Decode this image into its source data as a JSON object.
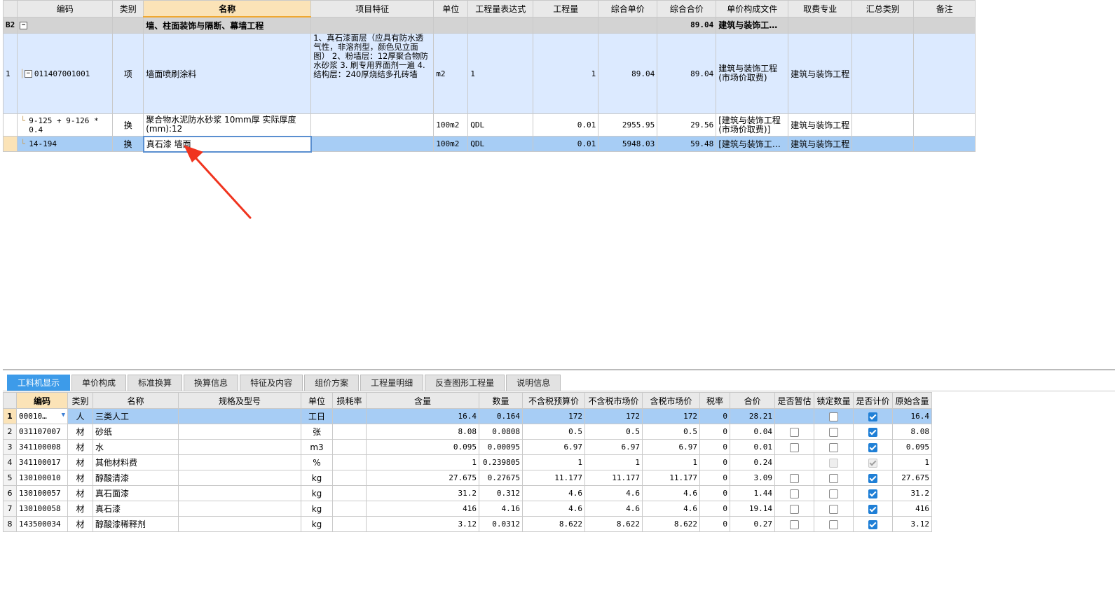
{
  "upper": {
    "columns": [
      "编码",
      "类别",
      "名称",
      "项目特征",
      "单位",
      "工程量表达式",
      "工程量",
      "综合单价",
      "综合合价",
      "单价构成文件",
      "取费专业",
      "汇总类别",
      "备注"
    ],
    "section": {
      "rownum": "B2",
      "name": "墙、柱面装饰与隔断、幕墙工程",
      "total": "89.04",
      "file": "建筑与装饰工…"
    },
    "item": {
      "rownum": "1",
      "code": "011407001001",
      "type": "项",
      "name": "墙面喷刷涂料",
      "features": "1、真石漆面层（应具有防水透气性，非溶剂型，颜色见立面图）\n2、粉墙层：12厚聚合物防水砂浆\n3. 刷专用界面剂一遍\n4.结构层：240厚烧结多孔砖墙",
      "unit": "m2",
      "expr": "1",
      "qty": "1",
      "price": "89.04",
      "total": "89.04",
      "file": "建筑与装饰工程(市场价取费)",
      "major": "建筑与装饰工程"
    },
    "subs": [
      {
        "code": "9-125 + 9-126 * 0.4",
        "type": "换",
        "name": "聚合物水泥防水砂浆 10mm厚  实际厚度(mm):12",
        "unit": "100m2",
        "expr": "QDL",
        "qty": "0.01",
        "price": "2955.95",
        "total": "29.56",
        "file": "[建筑与装饰工程(市场价取费)]",
        "major": "建筑与装饰工程"
      },
      {
        "code": "14-194",
        "type": "换",
        "name": "真石漆 墙面",
        "unit": "100m2",
        "expr": "QDL",
        "qty": "0.01",
        "price": "5948.03",
        "total": "59.48",
        "file": "[建筑与装饰工…",
        "major": "建筑与装饰工程"
      }
    ]
  },
  "tabs": [
    "工料机显示",
    "单价构成",
    "标准换算",
    "换算信息",
    "特征及内容",
    "组价方案",
    "工程量明细",
    "反查图形工程量",
    "说明信息"
  ],
  "lower": {
    "columns": [
      "编码",
      "类别",
      "名称",
      "规格及型号",
      "单位",
      "损耗率",
      "含量",
      "数量",
      "不含税预算价",
      "不含税市场价",
      "含税市场价",
      "税率",
      "合价",
      "是否暂估",
      "锁定数量",
      "是否计价",
      "原始含量"
    ],
    "rows": [
      {
        "n": "1",
        "code": "00010…",
        "type": "人",
        "name": "三类人工",
        "unit": "工日",
        "content": "16.4",
        "qty": "0.164",
        "budget": "172",
        "market": "172",
        "taxmarket": "172",
        "tax": "0",
        "total": "28.21",
        "temp": null,
        "lock": false,
        "price": true,
        "orig": "16.4"
      },
      {
        "n": "2",
        "code": "031107007",
        "type": "材",
        "name": "砂纸",
        "unit": "张",
        "content": "8.08",
        "qty": "0.0808",
        "budget": "0.5",
        "market": "0.5",
        "taxmarket": "0.5",
        "tax": "0",
        "total": "0.04",
        "temp": false,
        "lock": false,
        "price": true,
        "orig": "8.08"
      },
      {
        "n": "3",
        "code": "341100008",
        "type": "材",
        "name": "水",
        "unit": "m3",
        "content": "0.095",
        "qty": "0.00095",
        "budget": "6.97",
        "market": "6.97",
        "taxmarket": "6.97",
        "tax": "0",
        "total": "0.01",
        "temp": false,
        "lock": false,
        "price": true,
        "orig": "0.095"
      },
      {
        "n": "4",
        "code": "341100017",
        "type": "材",
        "name": "其他材料费",
        "unit": "%",
        "content": "1",
        "qty": "0.239805",
        "budget": "1",
        "market": "1",
        "taxmarket": "1",
        "tax": "0",
        "total": "0.24",
        "temp": null,
        "lock": "disabled",
        "price": "disabled",
        "orig": "1"
      },
      {
        "n": "5",
        "code": "130100010",
        "type": "材",
        "name": "醇酸清漆",
        "unit": "kg",
        "content": "27.675",
        "qty": "0.27675",
        "budget": "11.177",
        "market": "11.177",
        "taxmarket": "11.177",
        "tax": "0",
        "total": "3.09",
        "temp": false,
        "lock": false,
        "price": true,
        "orig": "27.675"
      },
      {
        "n": "6",
        "code": "130100057",
        "type": "材",
        "name": "真石面漆",
        "unit": "kg",
        "content": "31.2",
        "qty": "0.312",
        "budget": "4.6",
        "market": "4.6",
        "taxmarket": "4.6",
        "tax": "0",
        "total": "1.44",
        "temp": false,
        "lock": false,
        "price": true,
        "orig": "31.2"
      },
      {
        "n": "7",
        "code": "130100058",
        "type": "材",
        "name": "真石漆",
        "unit": "kg",
        "content": "416",
        "qty": "4.16",
        "budget": "4.6",
        "market": "4.6",
        "taxmarket": "4.6",
        "tax": "0",
        "total": "19.14",
        "temp": false,
        "lock": false,
        "price": true,
        "orig": "416"
      },
      {
        "n": "8",
        "code": "143500034",
        "type": "材",
        "name": "醇酸漆稀释剂",
        "unit": "kg",
        "content": "3.12",
        "qty": "0.0312",
        "budget": "8.622",
        "market": "8.622",
        "taxmarket": "8.622",
        "tax": "0",
        "total": "0.27",
        "temp": false,
        "lock": false,
        "price": true,
        "orig": "3.12"
      }
    ]
  },
  "annotation": {
    "color": "#f0341f",
    "icon": "red-arrow"
  }
}
